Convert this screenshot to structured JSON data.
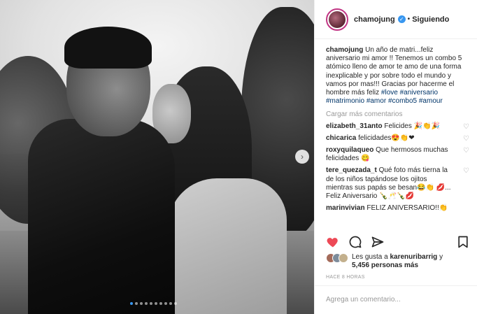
{
  "post": {
    "author": "chamojung",
    "follow_status": "Siguiendo",
    "separator": "•",
    "caption_prefix": "Un año de matri...feliz aniversario mi amor !! Tenemos un combo 5 atómico lleno de amor te amo de una forma inexplicable y por sobre todo el mundo y vamos por mas!!! Gracias por hacerme el hombre más feliz",
    "hashtags": [
      "#love",
      "#aniversario",
      "#matrimonio",
      "#amor",
      "#combo5",
      "#amour"
    ],
    "load_more": "Cargar más comentarios",
    "comments": [
      {
        "user": "elizabeth_31anto",
        "text": "Felicides 🎉👏🎉"
      },
      {
        "user": "chicarica",
        "text": "felicidades😍👏❤"
      },
      {
        "user": "roxyquilaqueo",
        "text": "Que hermosos muchas felicidades 😋"
      },
      {
        "user": "tere_quezada_t",
        "text": "Qué foto más tierna la de los niños tapándose los ojitos mientras sus papás se besan😂👏 💋... Feliz Aniversario 🍾🥂🍾💋"
      },
      {
        "user": "marinvivian",
        "text": "FELIZ ANIVERSARIO!!👏"
      }
    ],
    "likes_line1": "Les gusta a ",
    "likes_user": "karenuribarrig",
    "likes_conj": " y",
    "likes_count": "5,456 personas más",
    "time": "HACE 8 HORAS",
    "add_comment_placeholder": "Agrega un comentario...",
    "carousel_total": 10,
    "carousel_active": 0
  },
  "colors": {
    "like_red": "#ed4956",
    "link_blue": "#003569",
    "verified_blue": "#3897f0"
  },
  "icons": [
    "heart-icon",
    "comment-icon",
    "share-icon",
    "bookmark-icon",
    "next-arrow-icon",
    "verified-icon"
  ]
}
